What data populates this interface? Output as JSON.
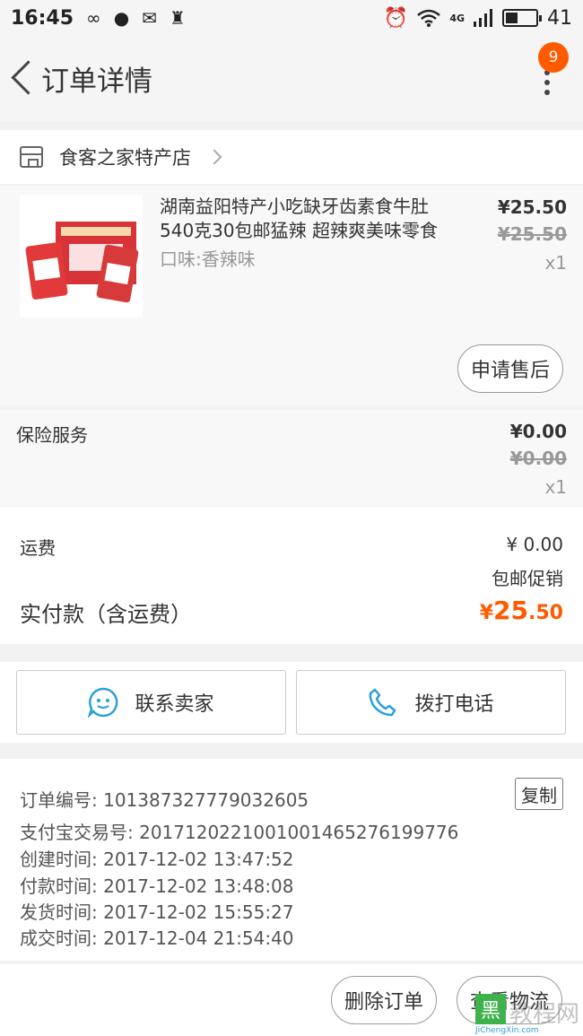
{
  "status_bar": {
    "time": "16:45",
    "network": "4G",
    "battery": "41",
    "battery_level": 0.41
  },
  "nav": {
    "title": "订单详情",
    "badge": "9"
  },
  "shop": {
    "name": "食客之家特产店"
  },
  "product": {
    "title_line1": "湖南益阳特产小吃缺牙齿素食牛肚",
    "title_line2": "540克30包邮猛辣 超辣爽美味零食",
    "spec": "口味:香辣味",
    "price": "¥25.50",
    "original_price": "¥25.50",
    "quantity": "x1",
    "after_sale_label": "申请售后"
  },
  "insurance": {
    "label": "保险服务",
    "price": "¥0.00",
    "original_price": "¥0.00",
    "quantity": "x1"
  },
  "fees": {
    "shipping_label": "运费",
    "shipping_value": "¥ 0.00",
    "promo": "包邮促销",
    "paid_label": "实付款（含运费）",
    "paid_symbol": "¥",
    "paid_int": "25",
    "paid_dec": ".50"
  },
  "contact": {
    "seller_label": "联系卖家",
    "call_label": "拨打电话"
  },
  "order_info": {
    "order_no": "订单编号: 101387327779032605",
    "alipay_no": "支付宝交易号: 2017120221001001465276199776",
    "created": "创建时间: 2017-12-02 13:47:52",
    "paid": "付款时间: 2017-12-02 13:48:08",
    "shipped": "发货时间: 2017-12-02 15:55:27",
    "completed": "成交时间: 2017-12-04 21:54:40",
    "copy_label": "复制"
  },
  "actions": {
    "delete_label": "删除订单",
    "logistics_label": "查看物流"
  },
  "watermark": {
    "logo": "黑",
    "name": "教程网",
    "url": "JiChengXin.com"
  },
  "colors": {
    "accent": "#ff5a00",
    "icon_blue": "#2aa1d8"
  }
}
